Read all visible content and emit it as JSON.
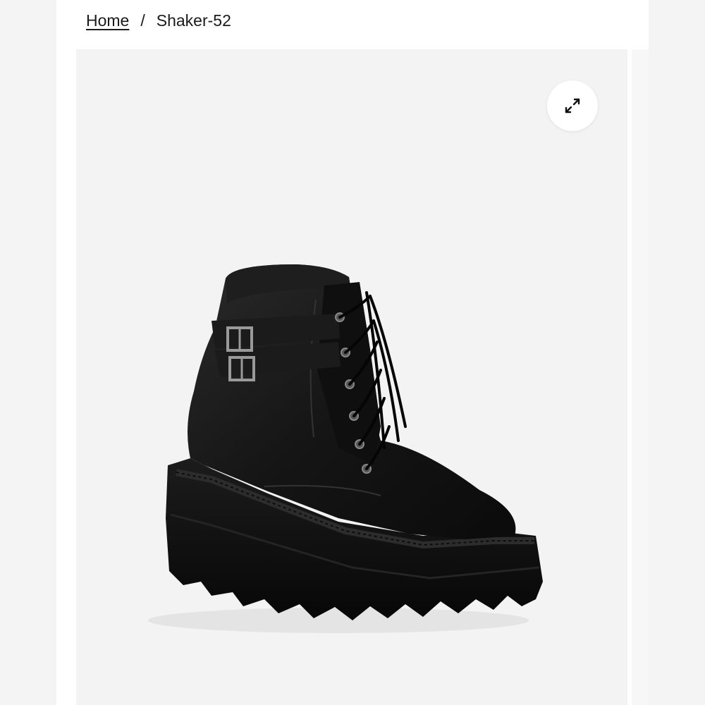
{
  "breadcrumb": {
    "home_label": "Home",
    "separator": "/",
    "current_label": "Shaker-52"
  },
  "gallery": {
    "zoom_icon": "expand-arrows-icon",
    "image_subject": "product-image-boot"
  },
  "colors": {
    "page_bg": "#ffffff",
    "gallery_bg": "#f3f3f4",
    "text": "#1a1a1a",
    "boot": "#111111"
  }
}
